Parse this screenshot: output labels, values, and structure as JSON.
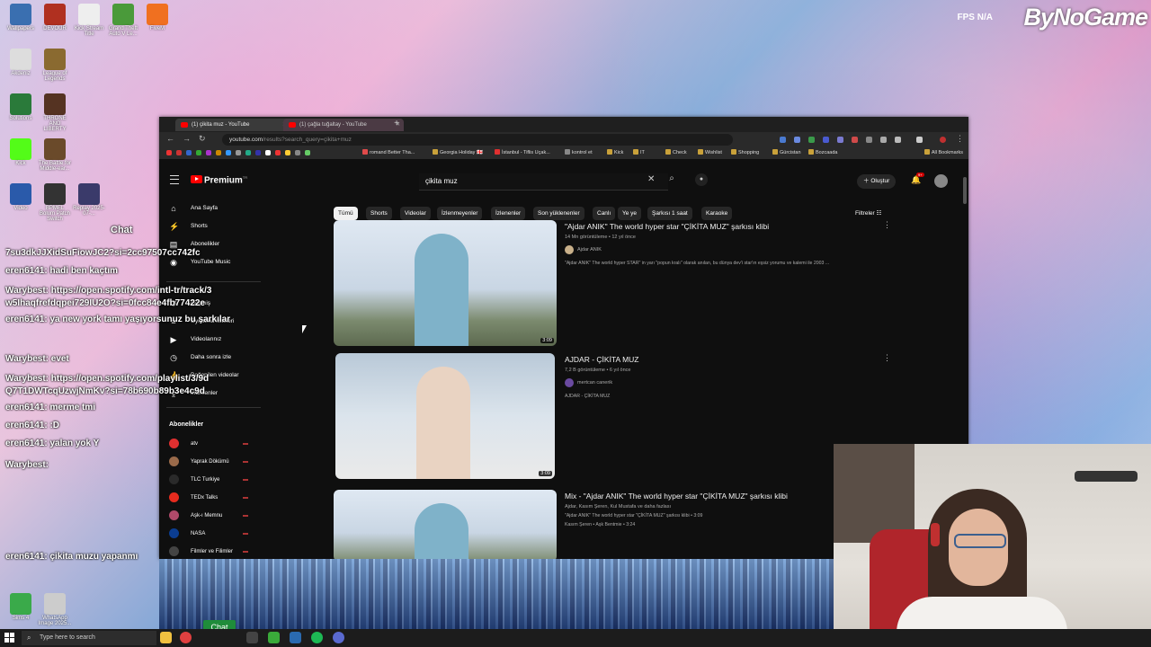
{
  "overlay": {
    "brand": "ByNoGame",
    "fps_label": "FPS",
    "fps_value": "N/A",
    "chat_button": "Chat"
  },
  "desktop_icons": [
    {
      "label": "Wallpapers",
      "color": "#3a6fb0"
    },
    {
      "label": "DEVOUR",
      "color": "#b03020"
    },
    {
      "label": "Kick Stream Title",
      "color": "#eeeeee"
    },
    {
      "label": "Grand Theft Auto V Le...",
      "color": "#4a9a3a"
    },
    {
      "label": "FiveM",
      "color": "#f07020"
    },
    {
      "label": "Akdeniz",
      "color": "#dddddd"
    },
    {
      "label": "League of Legends",
      "color": "#8a6a30"
    },
    {
      "label": "Solutions",
      "color": "#2a7a3a"
    },
    {
      "label": "THRONE AND LIBERTY",
      "color": "#553322"
    },
    {
      "label": "Kick",
      "color": "#53fc18"
    },
    {
      "label": "The Battle for Middle-ear...",
      "color": "#6a4a2a"
    },
    {
      "label": "Video",
      "color": "#2a5aaa"
    },
    {
      "label": "BPMEL Bolum Patch Switch",
      "color": "#333333"
    },
    {
      "label": "Replay 2025-07-...",
      "color": "#3a3a6a"
    },
    {
      "label": "Sims 4",
      "color": "#3aaa4a"
    },
    {
      "label": "WhatsApp Image 2025...",
      "color": "#cccccc"
    }
  ],
  "chat": {
    "title": "Chat",
    "lines": [
      "7su3dkJJXidSuFiowJC2?si=2cc97507cc742fc",
      "eren6141: hadi ben kaçtım",
      "Warybest: https://open.spotify.com/intl-tr/track/3",
      "w5Ihaqfrefdqpei729IU2O?si=0fcc84e4fb77422e",
      "eren6141: ya new york tamı yaşıyorsunuz bu şarkılar",
      "Warybest: evet",
      "Warybest: https://open.spotify.com/playlist/3/9d",
      "Q7T1DWTcqUzwjNmKv?si=78b690b89b3e4c9d",
      "eren6141: merme tmi",
      "eren6141: :D",
      "eren6141: yalan yok Y",
      "Warybest:",
      "eren6141: çikita muzu yapanmı"
    ]
  },
  "browser": {
    "tabs": [
      {
        "title": "(1) çikita muz - YouTube",
        "active": true
      },
      {
        "title": "(1) çağla tuğaltay - YouTube",
        "active": false
      }
    ],
    "url": "youtube.com",
    "url_rest": "/results?search_query=çikita+muz",
    "bookmarks": [
      "romand Better Tha...",
      "Georgia Holiday 🇬🇪",
      "İstanbul - Tiflis Uçak...",
      "kontrol et",
      "Kick",
      "IT",
      "Check",
      "Wishlist",
      "Shopping",
      "Gürcistan",
      "Bozcaada"
    ],
    "all_bookmarks": "All Bookmarks"
  },
  "youtube": {
    "logo": "Premium",
    "logo_region": "TR",
    "search_value": "çikita muz",
    "create_label": "Oluştur",
    "notif_count": "9+",
    "sidebar_main": [
      {
        "label": "Ana Sayfa",
        "icon": "home-icon",
        "glyph": "⌂"
      },
      {
        "label": "Shorts",
        "icon": "shorts-icon",
        "glyph": "⚡"
      },
      {
        "label": "Abonelikler",
        "icon": "subscriptions-icon",
        "glyph": "▤"
      },
      {
        "label": "YouTube Music",
        "icon": "music-icon",
        "glyph": "◉"
      }
    ],
    "sidebar_you": [
      {
        "label": "Geçmiş",
        "icon": "history-icon",
        "glyph": "↺"
      },
      {
        "label": "Oynatma listeleri",
        "icon": "playlist-icon",
        "glyph": "≡"
      },
      {
        "label": "Videolarınız",
        "icon": "your-videos-icon",
        "glyph": "▶"
      },
      {
        "label": "Daha sonra izle",
        "icon": "watch-later-icon",
        "glyph": "◷"
      },
      {
        "label": "Beğenilen videolar",
        "icon": "liked-icon",
        "glyph": "👍"
      },
      {
        "label": "İndirilenler",
        "icon": "download-icon",
        "glyph": "⤓"
      }
    ],
    "subs_heading": "Abonelikler",
    "subscriptions": [
      {
        "label": "atv",
        "color": "#e03030"
      },
      {
        "label": "Yaprak Dökümü",
        "color": "#9a6a4a"
      },
      {
        "label": "TLC Turkiye",
        "color": "#2a2a2a"
      },
      {
        "label": "TEDx Talks",
        "color": "#e62b1e"
      },
      {
        "label": "Aşk-ı Memnu",
        "color": "#b04a6a"
      },
      {
        "label": "NASA",
        "color": "#0b3d91"
      },
      {
        "label": "Filmler ve Filimler",
        "color": "#444444"
      }
    ],
    "chips": [
      {
        "label": "Tümü",
        "active": true
      },
      {
        "label": "Shorts",
        "active": false
      },
      {
        "label": "Videolar",
        "active": false
      },
      {
        "label": "İzlenmeyenler",
        "active": false
      },
      {
        "label": "İzlenenler",
        "active": false
      },
      {
        "label": "Son yüklenenler",
        "active": false
      },
      {
        "label": "Canlı",
        "active": false
      },
      {
        "label": "Ye ye",
        "active": false
      },
      {
        "label": "Şarkısı 1 saat",
        "active": false
      },
      {
        "label": "Karaoke",
        "active": false
      }
    ],
    "filters_label": "Filtreler",
    "videos": [
      {
        "title": "\"Ajdar ANIK\" The world hyper star \"ÇİKİTA MUZ\" şarkısı klibi",
        "meta": "14 Mn görüntüleme • 12 yıl önce",
        "channel": "Ajdar ANIK",
        "desc": "\"Ajdar ANIK\" The world hyper STAR\" in yarı \"popun kralı\" olarak anılan, bu dünya dev'i star'ın eşsiz yorumu ve kalemi ile 2003 ...",
        "duration": "3:09"
      },
      {
        "title": "AJDAR - ÇİKİTA MUZ",
        "meta": "7,2 B görüntüleme • 6 yıl önce",
        "channel": "mertcan canerik",
        "desc": "AJDAR - ÇİKİTA MUZ",
        "duration": "3:09"
      },
      {
        "title": "Mix - \"Ajdar ANIK\" The world hyper star \"ÇİKİTA MUZ\" şarkısı klibi",
        "meta": "Ajdar, Kasım Şeren, Kul Mustafa ve daha fazlası",
        "channel": "",
        "desc": "\"Ajdar ANIK\" The world hyper star \"ÇİKİTA MUZ\" şarkısı klibi • 3:09",
        "desc2": "Kasım Şeren • Aşk Bentmie • 3:24",
        "duration": ""
      }
    ]
  },
  "taskbar": {
    "search_placeholder": "Type here to search"
  }
}
